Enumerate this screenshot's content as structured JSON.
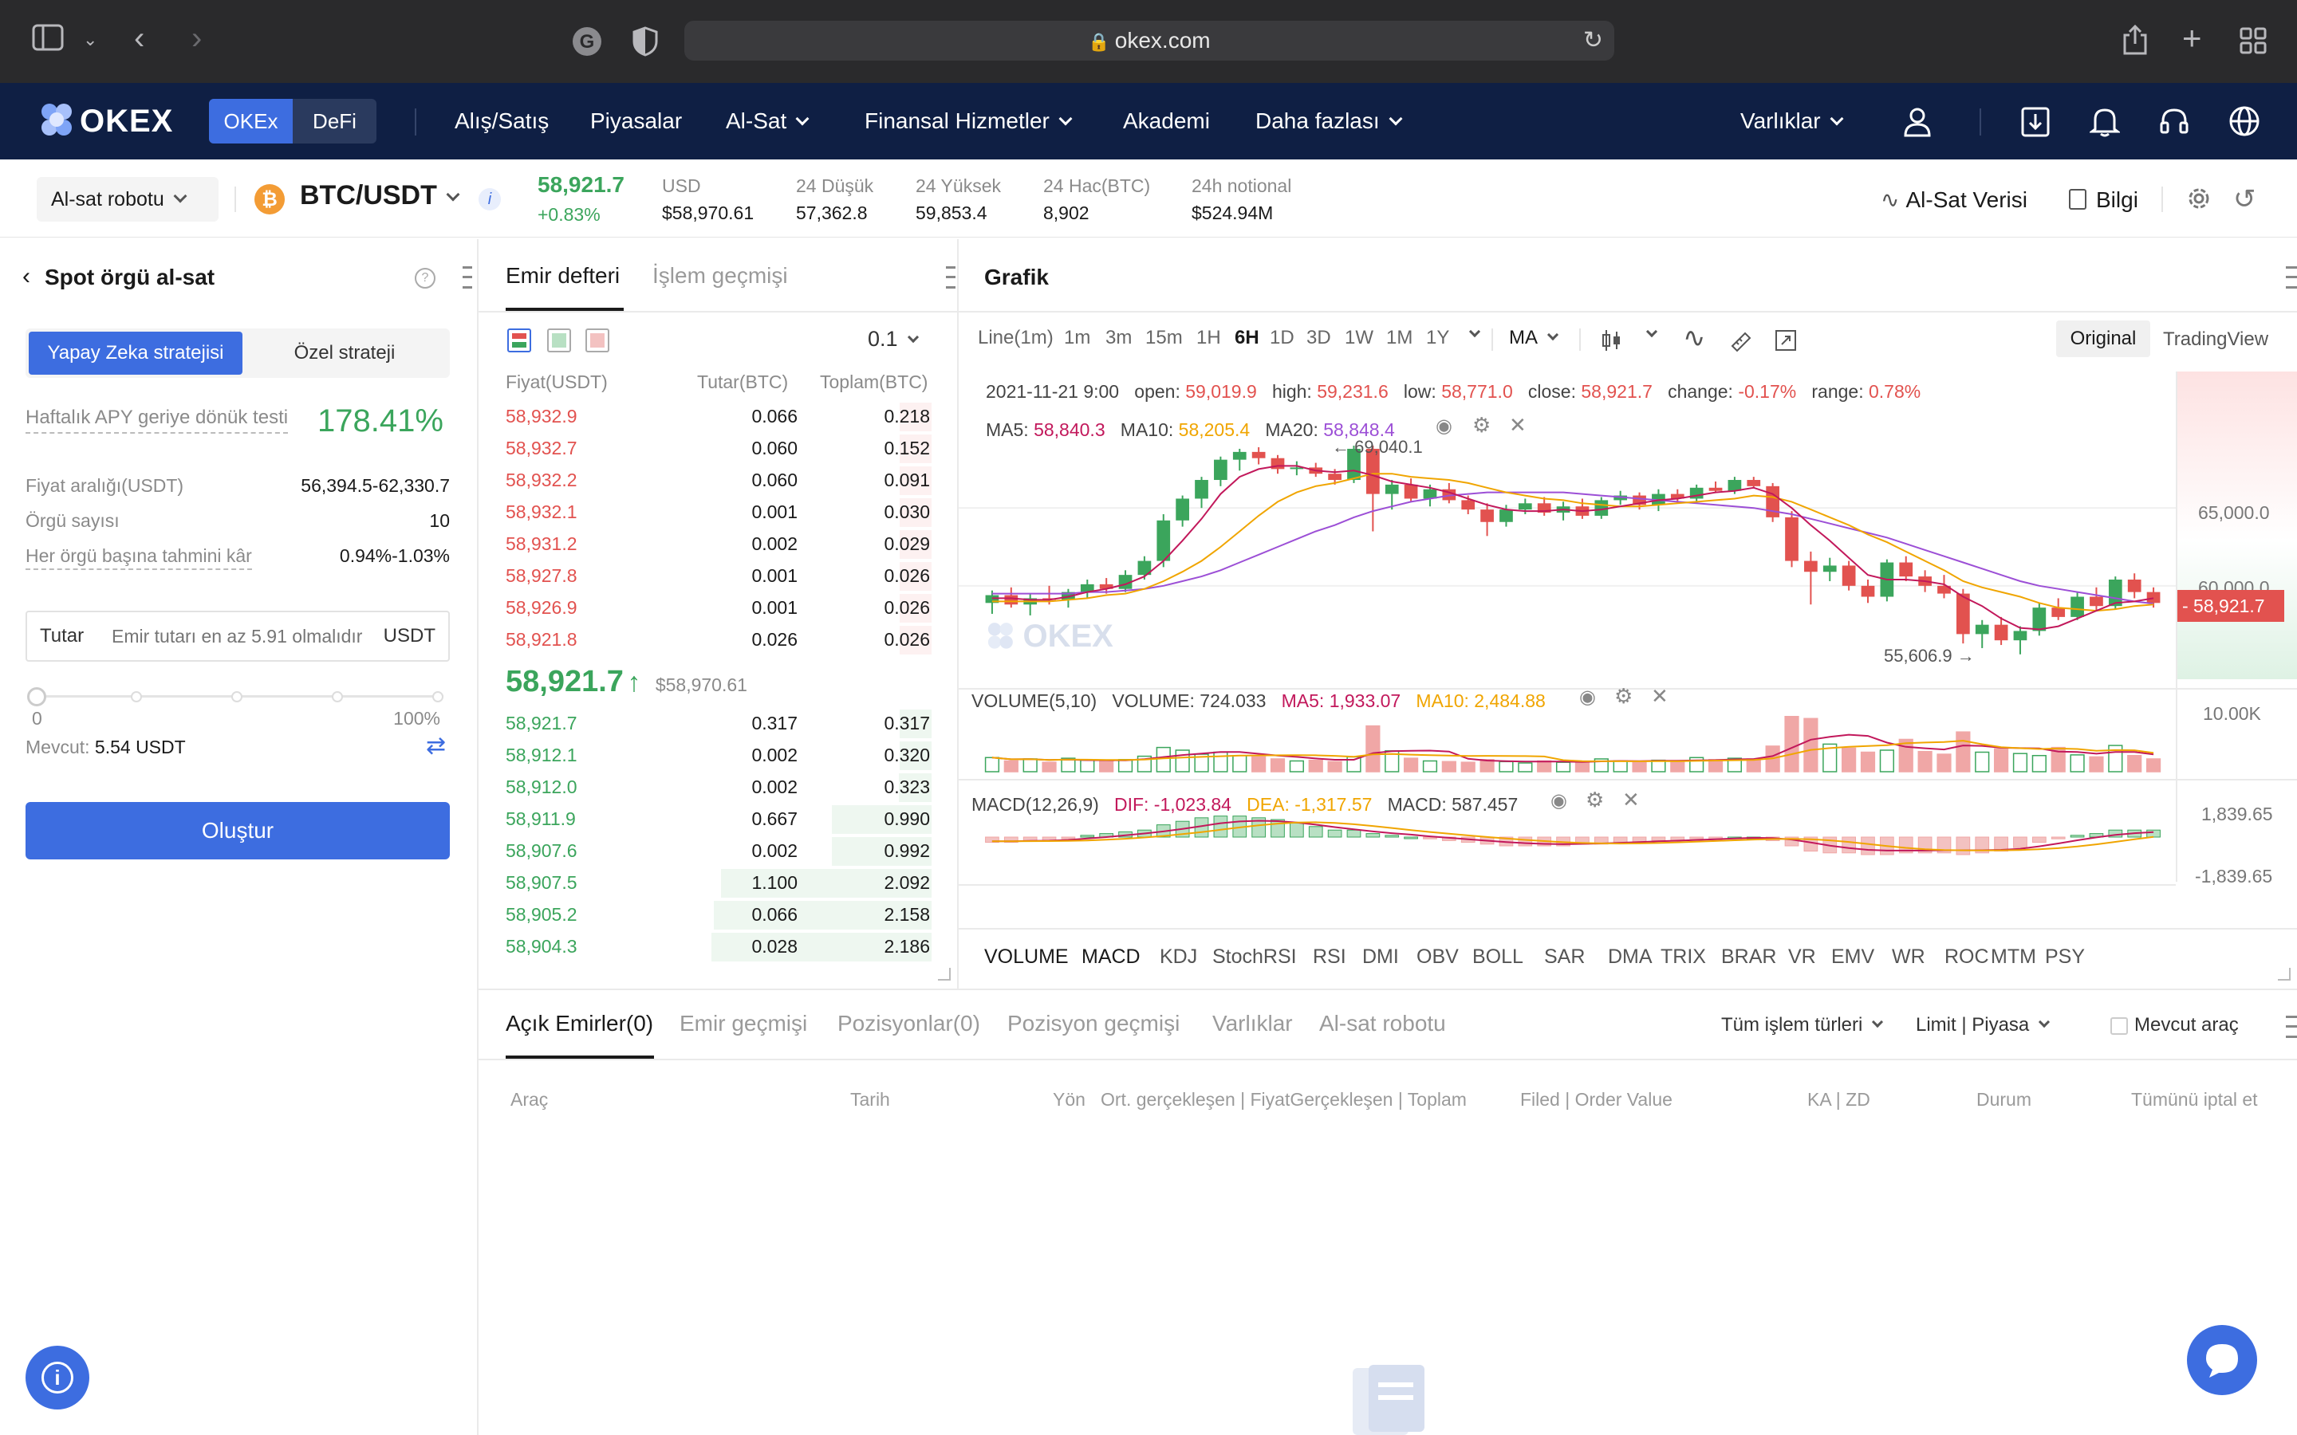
{
  "browser": {
    "url": "okex.com"
  },
  "nav": {
    "logo": "OKEX",
    "toggle": [
      "OKEx",
      "DeFi"
    ],
    "items": [
      "Alış/Satış",
      "Piyasalar",
      "Al-Sat",
      "Finansal Hizmetler",
      "Akademi",
      "Daha fazlası"
    ],
    "assets": "Varlıklar"
  },
  "ticker": {
    "robot_select": "Al-sat robotu",
    "pair": "BTC/USDT",
    "price": "58,921.7",
    "change": "+0.83%",
    "stats": [
      {
        "label": "USD",
        "value": "$58,970.61"
      },
      {
        "label": "24 Düşük",
        "value": "57,362.8"
      },
      {
        "label": "24 Yüksek",
        "value": "59,853.4"
      },
      {
        "label": "24 Hac(BTC)",
        "value": "8,902"
      },
      {
        "label": "24h notional",
        "value": "$524.94M"
      }
    ],
    "trade_data": "Al-Sat Verisi",
    "info": "Bilgi"
  },
  "left": {
    "title": "Spot örgü al-sat",
    "tabs": [
      "Yapay Zeka stratejisi",
      "Özel strateji"
    ],
    "apy_label": "Haftalık APY geriye dönük testi",
    "apy_value": "178.41%",
    "rows": [
      {
        "label": "Fiyat aralığı(USDT)",
        "value": "56,394.5-62,330.7"
      },
      {
        "label": "Örgü sayısı",
        "value": "10"
      },
      {
        "label": "Her örgü başına tahmini kâr",
        "value": "0.94%-1.03%"
      }
    ],
    "amount_label": "Tutar",
    "amount_placeholder": "Emir tutarı en az 5.91 olmalıdır",
    "amount_unit": "USDT",
    "slider_min": "0",
    "slider_max": "100%",
    "available_label": "Mevcut:",
    "available_value": "5.54 USDT",
    "create_button": "Oluştur"
  },
  "orderbook": {
    "tabs": [
      "Emir defteri",
      "İşlem geçmişi"
    ],
    "precision": "0.1",
    "headers": [
      "Fiyat(USDT)",
      "Tutar(BTC)",
      "Toplam(BTC)"
    ],
    "asks": [
      [
        "58,932.9",
        "0.066",
        "0.218"
      ],
      [
        "58,932.7",
        "0.060",
        "0.152"
      ],
      [
        "58,932.2",
        "0.060",
        "0.091"
      ],
      [
        "58,932.1",
        "0.001",
        "0.030"
      ],
      [
        "58,931.2",
        "0.002",
        "0.029"
      ],
      [
        "58,927.8",
        "0.001",
        "0.026"
      ],
      [
        "58,926.9",
        "0.001",
        "0.026"
      ],
      [
        "58,921.8",
        "0.026",
        "0.026"
      ]
    ],
    "last_price": "58,921.7",
    "last_usd": "$58,970.61",
    "bids": [
      [
        "58,921.7",
        "0.317",
        "0.317"
      ],
      [
        "58,912.1",
        "0.002",
        "0.320"
      ],
      [
        "58,912.0",
        "0.002",
        "0.323"
      ],
      [
        "58,911.9",
        "0.667",
        "0.990"
      ],
      [
        "58,907.6",
        "0.002",
        "0.992"
      ],
      [
        "58,907.5",
        "1.100",
        "2.092"
      ],
      [
        "58,905.2",
        "0.066",
        "2.158"
      ],
      [
        "58,904.3",
        "0.028",
        "2.186"
      ]
    ]
  },
  "chart": {
    "title": "Grafik",
    "timeframes": [
      "Line(1m)",
      "1m",
      "3m",
      "15m",
      "1H",
      "6H",
      "1D",
      "3D",
      "1W",
      "1M",
      "1Y"
    ],
    "active_timeframe": "6H",
    "ma_select": "MA",
    "views": [
      "Original",
      "TradingView"
    ],
    "ohlc": {
      "date": "2021-11-21 9:00",
      "open_label": "open:",
      "open": "59,019.9",
      "high_label": "high:",
      "high": "59,231.6",
      "low_label": "low:",
      "low": "58,771.0",
      "close_label": "close:",
      "close": "58,921.7",
      "change_label": "change:",
      "change": "-0.17%",
      "range_label": "range:",
      "range": "0.78%"
    },
    "ma_line": {
      "ma5_label": "MA5:",
      "ma5": "58,840.3",
      "ma10_label": "MA10:",
      "ma10": "58,205.4",
      "ma20_label": "MA20:",
      "ma20": "58,848.4"
    },
    "high_marker": "← 69,040.1",
    "low_marker": "55,606.9 →",
    "watermark": "OKEX",
    "price_axis": [
      "65,000.0",
      "60,000.0"
    ],
    "current_price_tag": "- 58,921.7",
    "volume": {
      "label": "VOLUME(5,10)",
      "value_label": "VOLUME: 724.033",
      "ma5": "MA5: 1,933.07",
      "ma10": "MA10: 2,484.88",
      "axis": "10.00K"
    },
    "macd": {
      "label": "MACD(12,26,9)",
      "dif": "DIF: -1,023.84",
      "dea": "DEA: -1,317.57",
      "macd": "MACD: 587.457",
      "axis_top": "1,839.65",
      "axis_bottom": "-1,839.65"
    },
    "indicators": [
      "VOLUME",
      "MACD",
      "KDJ",
      "StochRSI",
      "RSI",
      "DMI",
      "OBV",
      "BOLL",
      "SAR",
      "DMA",
      "TRIX",
      "BRAR",
      "VR",
      "EMV",
      "WR",
      "ROC",
      "MTM",
      "PSY"
    ],
    "colors": {
      "up": "#3ba55c",
      "down": "#e2524f",
      "ma5": "#c2185b",
      "ma10": "#f0a500",
      "ma20": "#9c4fd6"
    },
    "candles": [
      [
        58.9,
        59.7,
        58.2,
        59.4
      ],
      [
        59.4,
        59.9,
        58.6,
        58.8
      ],
      [
        58.8,
        59.5,
        58.1,
        59.2
      ],
      [
        59.2,
        60.0,
        58.8,
        59.1
      ],
      [
        59.1,
        59.8,
        58.6,
        59.6
      ],
      [
        59.6,
        60.4,
        59.2,
        60.1
      ],
      [
        60.1,
        60.5,
        59.5,
        59.8
      ],
      [
        59.8,
        61.0,
        59.6,
        60.7
      ],
      [
        60.7,
        61.9,
        60.4,
        61.6
      ],
      [
        61.6,
        64.6,
        61.2,
        64.2
      ],
      [
        64.2,
        65.8,
        63.8,
        65.6
      ],
      [
        65.6,
        67.0,
        65.0,
        66.8
      ],
      [
        66.8,
        68.3,
        66.4,
        68.1
      ],
      [
        68.1,
        68.8,
        67.4,
        68.6
      ],
      [
        68.6,
        68.9,
        67.8,
        68.2
      ],
      [
        68.2,
        68.4,
        67.2,
        67.5
      ],
      [
        67.5,
        68.0,
        67.1,
        67.6
      ],
      [
        67.6,
        67.9,
        67.0,
        67.2
      ],
      [
        67.2,
        67.5,
        66.5,
        66.8
      ],
      [
        66.8,
        69.0,
        66.6,
        68.8
      ],
      [
        68.8,
        69.0,
        63.5,
        65.9
      ],
      [
        65.9,
        66.8,
        64.9,
        66.5
      ],
      [
        66.5,
        66.9,
        65.4,
        65.6
      ],
      [
        65.6,
        66.5,
        65.1,
        66.2
      ],
      [
        66.2,
        66.6,
        65.3,
        65.5
      ],
      [
        65.5,
        65.8,
        64.6,
        64.9
      ],
      [
        64.9,
        65.3,
        63.2,
        64.1
      ],
      [
        64.1,
        65.2,
        63.8,
        64.9
      ],
      [
        64.9,
        65.6,
        64.6,
        65.3
      ],
      [
        65.3,
        65.7,
        64.5,
        64.7
      ],
      [
        64.7,
        65.4,
        64.2,
        65.1
      ],
      [
        65.1,
        65.6,
        64.3,
        64.5
      ],
      [
        64.5,
        65.7,
        64.3,
        65.5
      ],
      [
        65.5,
        66.1,
        65.2,
        65.8
      ],
      [
        65.8,
        66.0,
        64.9,
        65.2
      ],
      [
        65.2,
        66.2,
        64.8,
        65.9
      ],
      [
        65.9,
        66.2,
        65.3,
        65.6
      ],
      [
        65.6,
        66.5,
        65.3,
        66.3
      ],
      [
        66.3,
        66.7,
        66.0,
        66.1
      ],
      [
        66.1,
        67.0,
        65.9,
        66.8
      ],
      [
        66.8,
        67.0,
        66.3,
        66.4
      ],
      [
        66.4,
        66.6,
        64.1,
        64.4
      ],
      [
        64.4,
        64.8,
        61.2,
        61.6
      ],
      [
        61.6,
        62.2,
        58.8,
        60.9
      ],
      [
        60.9,
        61.8,
        60.3,
        61.3
      ],
      [
        61.3,
        61.6,
        59.7,
        60.0
      ],
      [
        60.0,
        60.4,
        58.9,
        59.3
      ],
      [
        59.3,
        61.7,
        59.0,
        61.5
      ],
      [
        61.5,
        61.9,
        60.3,
        60.6
      ],
      [
        60.6,
        61.0,
        59.6,
        60.0
      ],
      [
        60.0,
        60.7,
        59.2,
        59.5
      ],
      [
        59.5,
        59.8,
        56.3,
        56.9
      ],
      [
        56.9,
        57.8,
        56.0,
        57.5
      ],
      [
        57.5,
        58.0,
        56.2,
        56.5
      ],
      [
        56.5,
        57.4,
        55.6,
        57.1
      ],
      [
        57.1,
        58.9,
        56.8,
        58.6
      ],
      [
        58.6,
        59.2,
        57.8,
        58.0
      ],
      [
        58.0,
        59.6,
        57.8,
        59.3
      ],
      [
        59.3,
        59.9,
        58.4,
        58.7
      ],
      [
        58.7,
        60.6,
        58.5,
        60.4
      ],
      [
        60.4,
        60.8,
        59.2,
        59.6
      ],
      [
        59.6,
        59.9,
        58.6,
        58.9
      ]
    ],
    "ma_series": {
      "ma5": [
        59.2,
        59.2,
        59.1,
        59.1,
        59.3,
        59.6,
        59.8,
        60.1,
        60.6,
        61.6,
        62.9,
        64.3,
        65.9,
        67.0,
        67.5,
        67.7,
        67.7,
        67.4,
        67.3,
        67.4,
        67.1,
        66.7,
        66.5,
        66.3,
        66.0,
        65.6,
        65.2,
        64.9,
        64.8,
        64.8,
        64.9,
        64.8,
        64.9,
        65.1,
        65.3,
        65.5,
        65.6,
        65.8,
        66.0,
        66.1,
        66.3,
        65.9,
        65.0,
        63.9,
        62.9,
        61.8,
        60.7,
        60.4,
        60.4,
        60.3,
        60.1,
        59.3,
        58.7,
        57.9,
        57.3,
        57.2,
        57.4,
        57.9,
        58.4,
        58.9,
        59.0,
        59.2
      ],
      "ma10": [
        59.0,
        59.0,
        59.0,
        59.0,
        59.1,
        59.2,
        59.4,
        59.5,
        59.8,
        60.3,
        60.9,
        61.6,
        62.5,
        63.5,
        64.5,
        65.4,
        66.0,
        66.4,
        66.6,
        66.9,
        67.2,
        67.2,
        67.0,
        66.9,
        66.8,
        66.6,
        66.3,
        66.0,
        65.8,
        65.6,
        65.5,
        65.3,
        65.2,
        65.1,
        65.1,
        65.2,
        65.3,
        65.4,
        65.5,
        65.6,
        65.8,
        65.7,
        65.4,
        64.9,
        64.4,
        63.9,
        63.3,
        62.8,
        62.2,
        61.6,
        61.0,
        60.3,
        59.9,
        59.6,
        59.3,
        58.9,
        58.6,
        58.5,
        58.4,
        58.5,
        58.7,
        58.8
      ],
      "ma20": [
        59.5,
        59.5,
        59.5,
        59.5,
        59.5,
        59.6,
        59.6,
        59.7,
        59.8,
        60.0,
        60.3,
        60.6,
        61.0,
        61.5,
        62.0,
        62.5,
        63.0,
        63.5,
        63.9,
        64.4,
        64.8,
        65.1,
        65.4,
        65.6,
        65.8,
        65.9,
        66.0,
        66.0,
        66.0,
        66.0,
        66.0,
        65.9,
        65.8,
        65.7,
        65.6,
        65.5,
        65.4,
        65.3,
        65.2,
        65.1,
        65.0,
        64.8,
        64.6,
        64.3,
        64.0,
        63.7,
        63.4,
        63.1,
        62.7,
        62.3,
        61.9,
        61.5,
        61.1,
        60.7,
        60.3,
        60.0,
        59.8,
        59.6,
        59.4,
        59.2,
        59.0,
        58.85
      ]
    },
    "volumes": [
      2.1,
      1.6,
      1.9,
      1.4,
      2.0,
      1.7,
      1.5,
      1.8,
      2.3,
      3.6,
      3.2,
      2.6,
      2.9,
      2.4,
      2.2,
      1.9,
      1.6,
      1.7,
      1.5,
      2.2,
      6.8,
      3.1,
      2.0,
      1.6,
      1.5,
      1.4,
      1.8,
      1.5,
      1.3,
      1.6,
      1.4,
      1.5,
      1.9,
      1.6,
      1.4,
      1.7,
      1.6,
      2.1,
      1.8,
      2.0,
      1.9,
      3.8,
      8.2,
      7.9,
      4.1,
      3.5,
      2.9,
      3.2,
      4.8,
      3.0,
      2.6,
      5.9,
      2.9,
      3.4,
      2.7,
      2.4,
      3.6,
      2.5,
      2.2,
      3.9,
      2.4,
      1.9
    ],
    "macd_hist": [
      -0.3,
      -0.3,
      -0.2,
      -0.2,
      -0.1,
      0.1,
      0.2,
      0.3,
      0.4,
      0.7,
      0.9,
      1.1,
      1.2,
      1.2,
      1.1,
      1.0,
      0.8,
      0.6,
      0.4,
      0.4,
      0.2,
      0.1,
      0.0,
      -0.1,
      -0.2,
      -0.3,
      -0.4,
      -0.5,
      -0.5,
      -0.5,
      -0.5,
      -0.4,
      -0.4,
      -0.3,
      -0.3,
      -0.2,
      -0.2,
      -0.1,
      -0.1,
      0.0,
      0.0,
      -0.2,
      -0.5,
      -0.8,
      -0.9,
      -0.9,
      -1.0,
      -1.0,
      -0.9,
      -0.9,
      -0.9,
      -1.0,
      -0.9,
      -0.8,
      -0.6,
      -0.3,
      -0.1,
      0.1,
      0.2,
      0.4,
      0.4,
      0.4
    ]
  },
  "bottom": {
    "tabs": [
      "Açık Emirler(0)",
      "Emir geçmişi",
      "Pozisyonlar(0)",
      "Pozisyon geçmişi",
      "Varlıklar",
      "Al-sat robotu"
    ],
    "filter_type": "Tüm işlem türleri",
    "filter_order": "Limit | Piyasa",
    "current_checkbox": "Mevcut araç",
    "columns": [
      "Araç",
      "Tarih",
      "Yön",
      "Ort. gerçekleşen | FiyatGerçekleşen | Toplam",
      "Filed | Order Value",
      "KA | ZD",
      "Durum",
      "Tümünü iptal et"
    ]
  }
}
